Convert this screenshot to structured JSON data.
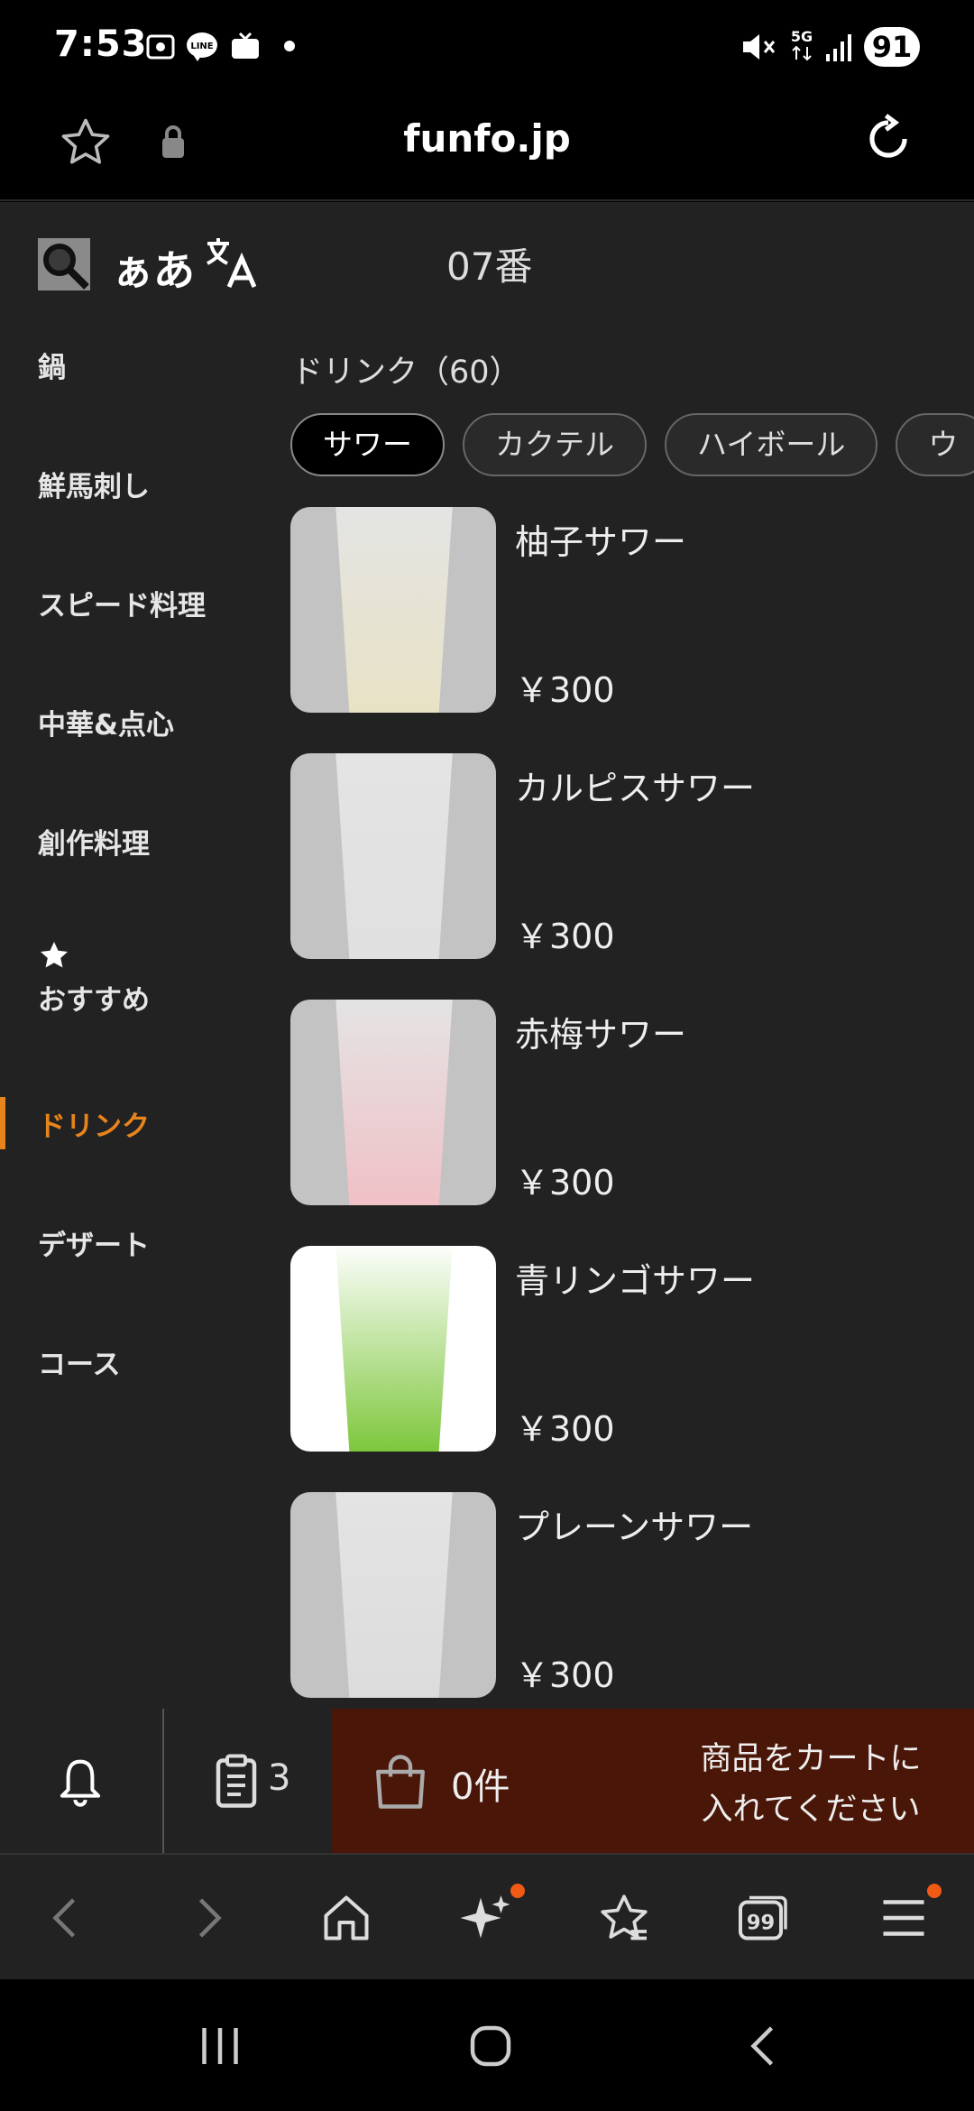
{
  "status_bar": {
    "time": "7:53",
    "battery": "91",
    "network": "5G",
    "icons": [
      "screenshot-icon",
      "line-icon",
      "tv-icon",
      "dot-icon",
      "mute-icon",
      "5g-icon",
      "signal-icon",
      "battery-icon"
    ]
  },
  "browser": {
    "url": "funfo.jp",
    "icons": [
      "star-icon",
      "lock-icon",
      "reload-icon"
    ]
  },
  "toolbar": {
    "kana_label": "ぁあ",
    "table_number": "07番",
    "icons": [
      "search-icon",
      "translate-icon"
    ]
  },
  "sidebar": {
    "items": [
      {
        "label": "鍋",
        "active": false
      },
      {
        "label": "鮮馬刺し",
        "active": false
      },
      {
        "label": "スピード料理",
        "active": false
      },
      {
        "label": "中華&点心",
        "active": false
      },
      {
        "label": "創作料理",
        "active": false
      },
      {
        "label": "おすすめ",
        "active": false,
        "icon": "star-icon"
      },
      {
        "label": "ドリンク",
        "active": true
      },
      {
        "label": "デザート",
        "active": false
      },
      {
        "label": "コース",
        "active": false
      }
    ],
    "active_color": "#e8841c"
  },
  "section": {
    "title": "ドリンク（60）"
  },
  "chips": [
    {
      "label": "サワー",
      "active": true
    },
    {
      "label": "カクテル",
      "active": false
    },
    {
      "label": "ハイボール",
      "active": false
    },
    {
      "label": "ウ",
      "active": false
    }
  ],
  "products": [
    {
      "name": "柚子サワー",
      "price": "￥300",
      "drink_color": "#e8e2c4"
    },
    {
      "name": "カルピスサワー",
      "price": "￥300",
      "drink_color": "#e0e0e0"
    },
    {
      "name": "赤梅サワー",
      "price": "￥300",
      "drink_color": "#f0c0c6"
    },
    {
      "name": "青リンゴサワー",
      "price": "￥300",
      "drink_color": "#7cc63a"
    },
    {
      "name": "プレーンサワー",
      "price": "￥300",
      "drink_color": "#dcdcdc"
    }
  ],
  "action_bar": {
    "order_count": "3",
    "cart_count": "0件",
    "cart_message": "商品をカートに入れてください",
    "cart_color": "#4a1608"
  },
  "nav_bar": {
    "icons": [
      "back-icon",
      "forward-icon",
      "home-icon",
      "sparkle-icon",
      "favorites-icon",
      "tabs-icon",
      "menu-icon"
    ],
    "tabs_count": "99",
    "badge_color": "#f05a14"
  }
}
